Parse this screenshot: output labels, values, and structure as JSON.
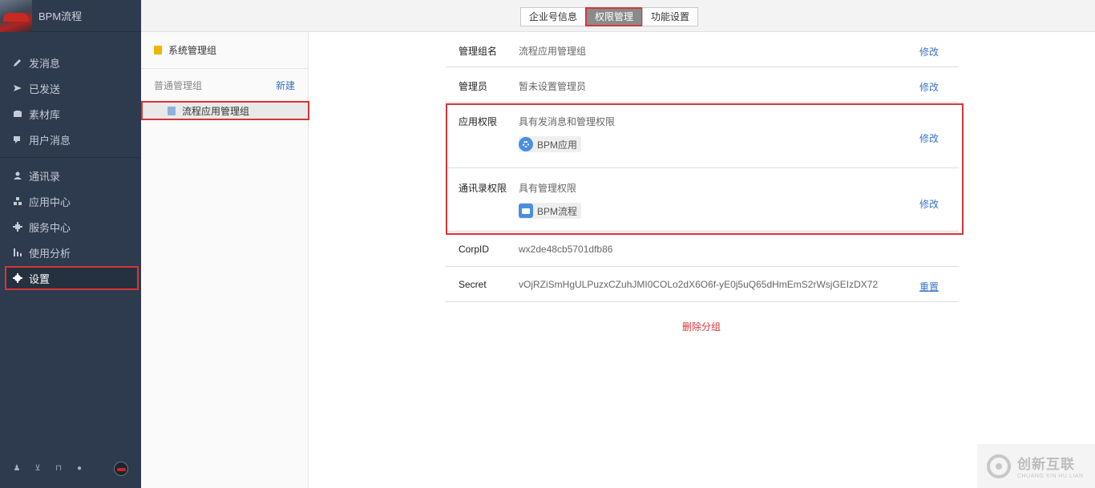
{
  "brand": {
    "name": "BPM流程"
  },
  "sidebar": {
    "items": [
      {
        "label": "发消息",
        "icon": "pencil-icon"
      },
      {
        "label": "已发送",
        "icon": "send-icon"
      },
      {
        "label": "素材库",
        "icon": "folder-icon"
      },
      {
        "label": "用户消息",
        "icon": "chat-icon"
      },
      {
        "label": "通讯录",
        "icon": "contact-icon"
      },
      {
        "label": "应用中心",
        "icon": "app-center-icon"
      },
      {
        "label": "服务中心",
        "icon": "service-icon"
      },
      {
        "label": "使用分析",
        "icon": "chart-icon"
      },
      {
        "label": "设置",
        "icon": "gear-icon",
        "active": true
      }
    ],
    "footer_icons": [
      "person-icon",
      "cart-icon",
      "book-icon",
      "help-icon",
      "avatar-icon"
    ]
  },
  "tabs": [
    {
      "label": "企业号信息"
    },
    {
      "label": "权限管理",
      "active": true
    },
    {
      "label": "功能设置"
    }
  ],
  "groups": {
    "system_group": "系统管理组",
    "normal_group_label": "普通管理组",
    "new_label": "新建",
    "items": [
      {
        "label": "流程应用管理组",
        "selected": true
      }
    ]
  },
  "details": {
    "group_name": {
      "key": "管理组名",
      "value": "流程应用管理组",
      "action": "修改"
    },
    "admin": {
      "key": "管理员",
      "value": "暂未设置管理员",
      "action": "修改"
    },
    "app_permission": {
      "key": "应用权限",
      "value": "具有发消息和管理权限",
      "chip": "BPM应用",
      "action": "修改"
    },
    "contact_permission": {
      "key": "通讯录权限",
      "value": "具有管理权限",
      "chip": "BPM流程",
      "action": "修改"
    },
    "corpid": {
      "key": "CorpID",
      "value": "wx2de48cb5701dfb86"
    },
    "secret": {
      "key": "Secret",
      "value": "vOjRZiSmHgULPuzxCZuhJMI0COLo2dX6O6f-yE0j5uQ65dHmEmS2rWsjGEIzDX72",
      "action": "重置"
    },
    "delete_label": "删除分组"
  },
  "watermark": {
    "title": "创新互联",
    "subtitle": "CHUANG XIN HU LIAN"
  },
  "colors": {
    "sidebar_bg": "#2e3a4d",
    "highlight": "#d9343a",
    "link": "#3a74c4",
    "tab_active": "#8a8a8a"
  }
}
